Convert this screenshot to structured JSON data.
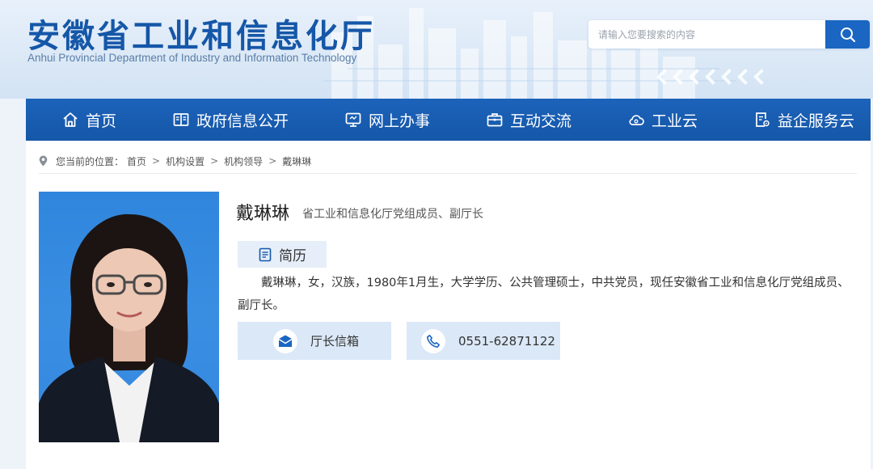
{
  "header": {
    "title_cn": "安徽省工业和信息化厅",
    "title_en": "Anhui Provincial Department of Industry and Information Technology",
    "search_placeholder": "请输入您要搜索的内容"
  },
  "nav": {
    "items": [
      {
        "label": "首页",
        "icon": "home-icon"
      },
      {
        "label": "政府信息公开",
        "icon": "book-icon"
      },
      {
        "label": "网上办事",
        "icon": "monitor-icon"
      },
      {
        "label": "互动交流",
        "icon": "briefcase-icon"
      },
      {
        "label": "工业云",
        "icon": "cloud-icon"
      },
      {
        "label": "益企服务云",
        "icon": "document-gear-icon"
      }
    ]
  },
  "breadcrumb": {
    "prefix": "您当前的位置：",
    "items": [
      "首页",
      "机构设置",
      "机构领导",
      "戴琳琳"
    ],
    "separator": ">"
  },
  "profile": {
    "name": "戴琳琳",
    "title": "省工业和信息化厅党组成员、副厅长",
    "resume_label": "简历",
    "bio": "戴琳琳，女，汉族，1980年1月生，大学学历、公共管理硕士，中共党员，现任安徽省工业和信息化厅党组成员、副厅长。"
  },
  "contacts": {
    "mailbox_label": "厅长信箱",
    "phone": "0551-62871122"
  },
  "colors": {
    "brand_blue": "#1557a8",
    "nav_blue": "#1c63ba",
    "search_button": "#1a66c2",
    "contact_bg": "#dbe8f7"
  }
}
